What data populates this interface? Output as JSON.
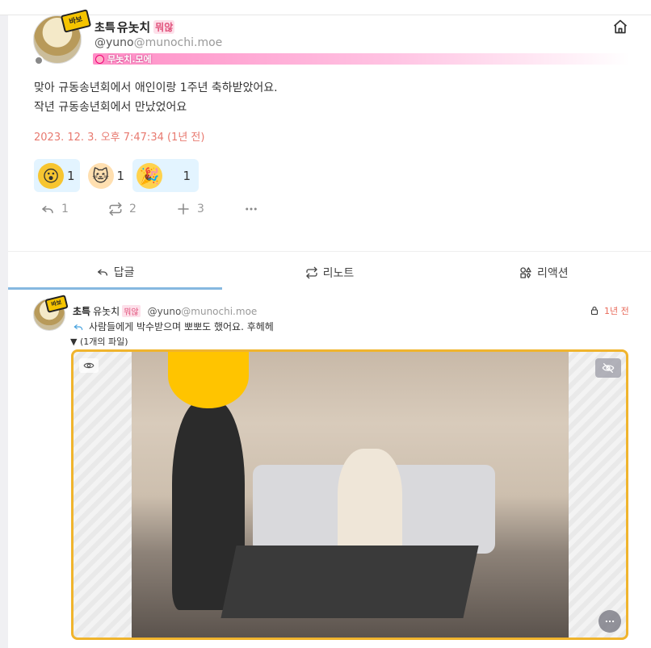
{
  "note": {
    "author": {
      "display_prefix": "초특",
      "display_name": "유놋치",
      "name_badge": "뭐않",
      "username": "@yuno",
      "host": "@munochi.moe",
      "avatar_badge": "바보",
      "online_status": "offline"
    },
    "instance": {
      "name": "무놋치.모에",
      "color": "#ff8ec6"
    },
    "text_line1": "맞아 규동송년회에서 애인이랑 1주년 축하받았어요.",
    "text_line2": "작년 규동송년회에서 만났었어요",
    "timestamp": "2023. 12. 3. 오후 7:47:34 (1년 전)",
    "reactions": [
      {
        "icon": "surprised-face-emoji",
        "glyph": "😮",
        "count": "1"
      },
      {
        "icon": "cat-emoji",
        "glyph": "🐱",
        "count": "1"
      },
      {
        "icon": "party-emoji",
        "glyph": "🎉",
        "count": "1"
      }
    ],
    "actions": {
      "reply_count": "1",
      "renote_count": "2",
      "react_count": "3"
    }
  },
  "tabs": [
    {
      "label": "답글",
      "active": true
    },
    {
      "label": "리노트",
      "active": false
    },
    {
      "label": "리액션",
      "active": false
    }
  ],
  "reply": {
    "author": {
      "display_prefix": "초특",
      "display_name": "유놋치",
      "name_badge": "뭐않",
      "username": "@yuno",
      "host": "@munochi.moe",
      "avatar_badge": "바보"
    },
    "time": "1년 전",
    "visibility": "followers-only",
    "text": "사람들에게 박수받으며 뽀뽀도 했어요. 후헤헤",
    "files_toggle": "▼ (1개의 파일)",
    "accent_color": "#f0b42d"
  }
}
